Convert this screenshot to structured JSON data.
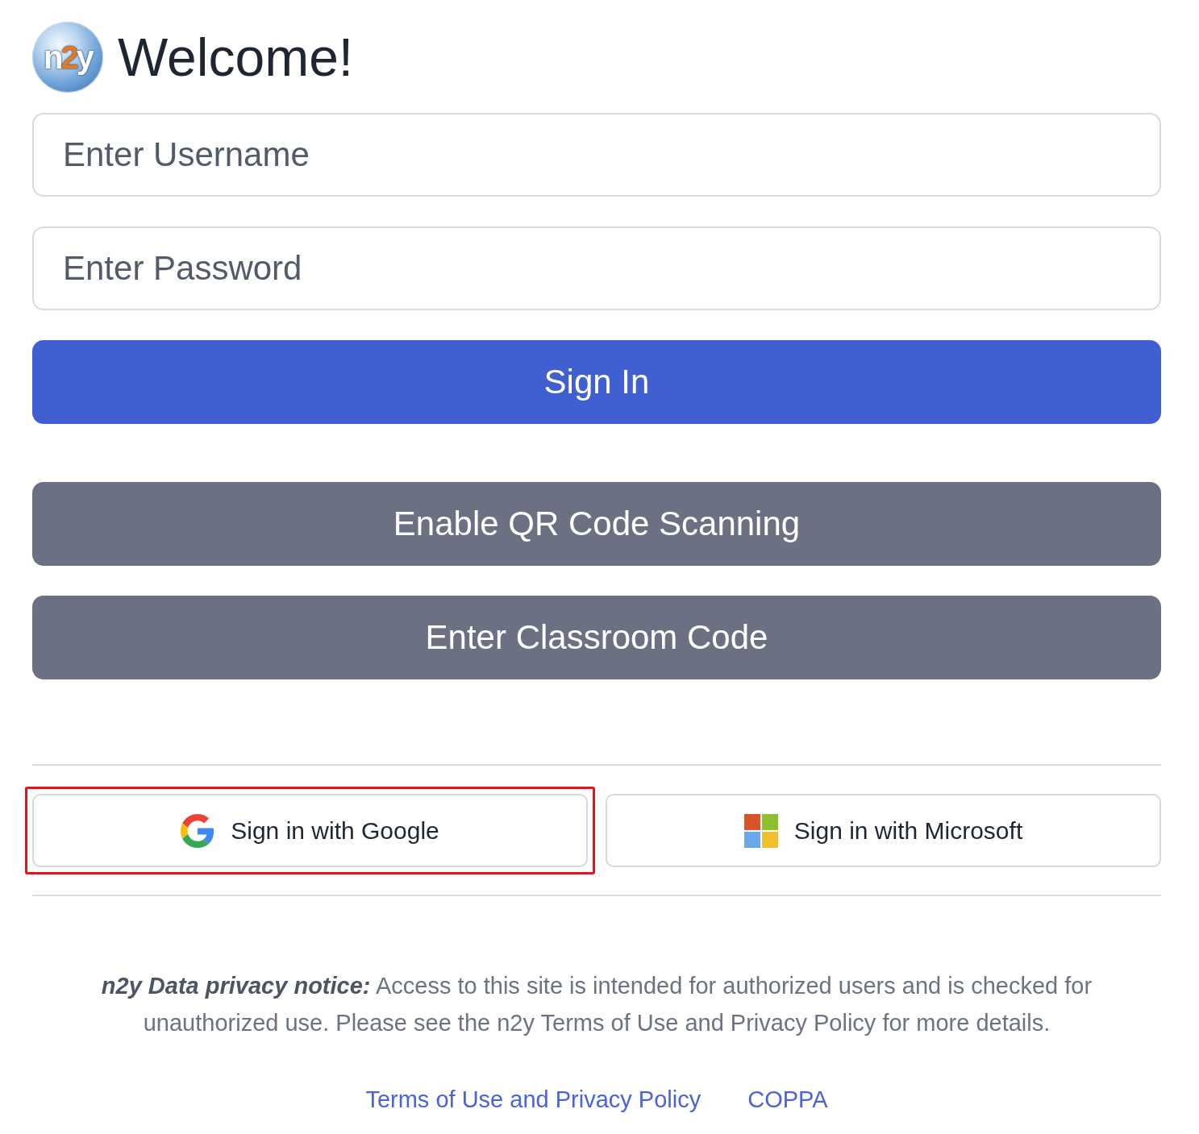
{
  "header": {
    "logo": {
      "letters": [
        {
          "text": "n",
          "color": "#ffffff"
        },
        {
          "text": "2",
          "color": "#e8791e"
        },
        {
          "text": "y",
          "color": "#ffffff"
        }
      ]
    },
    "title": "Welcome!"
  },
  "username_field": {
    "placeholder": "Enter Username"
  },
  "password_field": {
    "placeholder": "Enter Password"
  },
  "buttons": [
    {
      "kind": "primary",
      "label": "Sign In"
    },
    {
      "kind": "secondary",
      "label": "Enable QR Code Scanning"
    },
    {
      "kind": "secondary",
      "label": "Enter Classroom Code"
    }
  ],
  "sso_buttons": [
    {
      "kind": "google",
      "label": "Sign in with Google",
      "highlighted": true
    },
    {
      "kind": "microsoft",
      "label": "Sign in with Microsoft",
      "highlighted": false
    }
  ],
  "privacy_notice": {
    "lead": "n2y Data privacy notice:",
    "text": "Access to this site is intended for authorized users and is checked for unauthorized use. Please see the n2y Terms of Use and Privacy Policy for more details."
  },
  "links": [
    "Terms of Use and Privacy Policy",
    "COPPA"
  ]
}
